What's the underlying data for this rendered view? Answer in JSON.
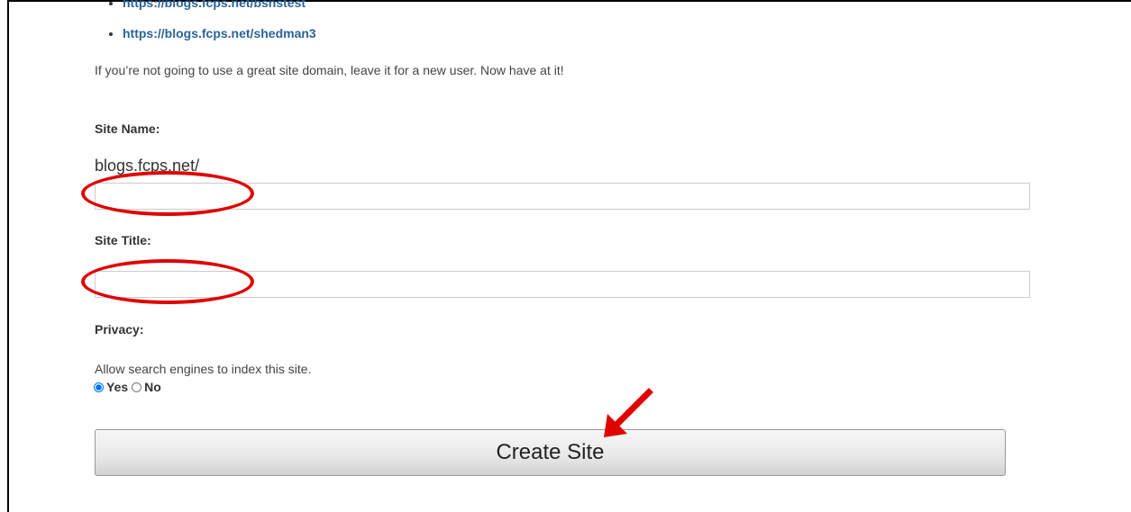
{
  "site_links": [
    {
      "url": "https://blogs.fcps.net/bsnstest"
    },
    {
      "url": "https://blogs.fcps.net/shedman3"
    }
  ],
  "intro_text": "If you’re not going to use a great site domain, leave it for a new user. Now have at it!",
  "form": {
    "site_name": {
      "label": "Site Name:",
      "prefix": "blogs.fcps.net/",
      "value": ""
    },
    "site_title": {
      "label": "Site Title:",
      "value": ""
    },
    "privacy": {
      "label": "Privacy:",
      "description": "Allow search engines to index this site.",
      "options": [
        {
          "label": "Yes",
          "selected": true
        },
        {
          "label": "No",
          "selected": false
        }
      ]
    },
    "submit_label": "Create Site"
  },
  "annotations": {
    "color": "#e00000"
  }
}
